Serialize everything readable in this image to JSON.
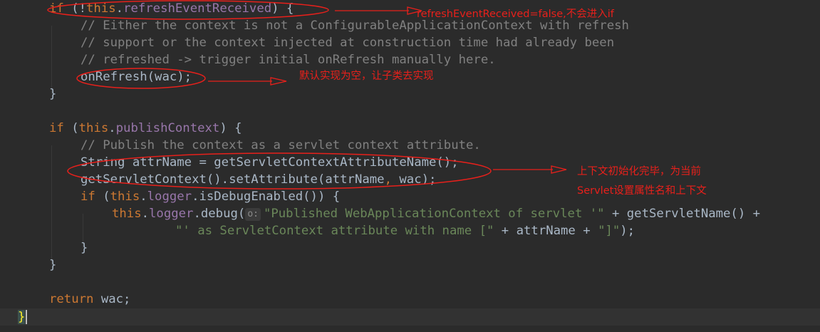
{
  "code": {
    "l1": {
      "kw": "if",
      "p1": " (!",
      "this": "this",
      "dot": ".",
      "field": "refreshEventReceived",
      "p2": ") {"
    },
    "l2": "// Either the context is not a ConfigurableApplicationContext with refresh",
    "l3": "// support or the context injected at construction time had already been",
    "l4": "// refreshed -> trigger initial onRefresh manually here.",
    "l5": "onRefresh(wac);",
    "l6": "}",
    "l8": {
      "kw": "if",
      "p1": " (",
      "this": "this",
      "dot": ".",
      "field": "publishContext",
      "p2": ") {"
    },
    "l9": "// Publish the context as a servlet context attribute.",
    "l10": "String attrName = getServletContextAttributeName();",
    "l11": {
      "a": "getServletContext().setAttribute(attrName",
      "comma": ",",
      "b": " wac);"
    },
    "l12": {
      "kw": "if",
      "p1": " (",
      "this": "this",
      "dot": ".",
      "field": "logger",
      "p2": ".isDebugEnabled()) {"
    },
    "l13": {
      "this": "this",
      "dot": ".",
      "field": "logger",
      "call": ".debug(",
      "hint": "o:",
      "str": "\"Published WebApplicationContext of servlet '\"",
      "rest": " + getServletName() +"
    },
    "l14": {
      "str": "\"' as ServletContext attribute with name [\"",
      "rest": " + attrName + ",
      "str2": "\"]\"",
      "end": ");"
    },
    "l15": "}",
    "l16": "}",
    "l18": {
      "kw": "return",
      "rest": " wac;"
    },
    "l19": "}"
  },
  "annotations": {
    "a1": "refreshEventReceived=false,不会进入if",
    "a2": "默认实现为空，让子类去实现",
    "a3_line1": "上下文初始化完毕，为当前",
    "a3_line2": "Servlet设置属性名和上下文"
  },
  "colors": {
    "background": "#2b2b2b",
    "keyword": "#cc7832",
    "field": "#9876aa",
    "comment": "#808080",
    "string": "#6a8759",
    "text": "#a9b7c6",
    "annotation": "#e8201b"
  }
}
